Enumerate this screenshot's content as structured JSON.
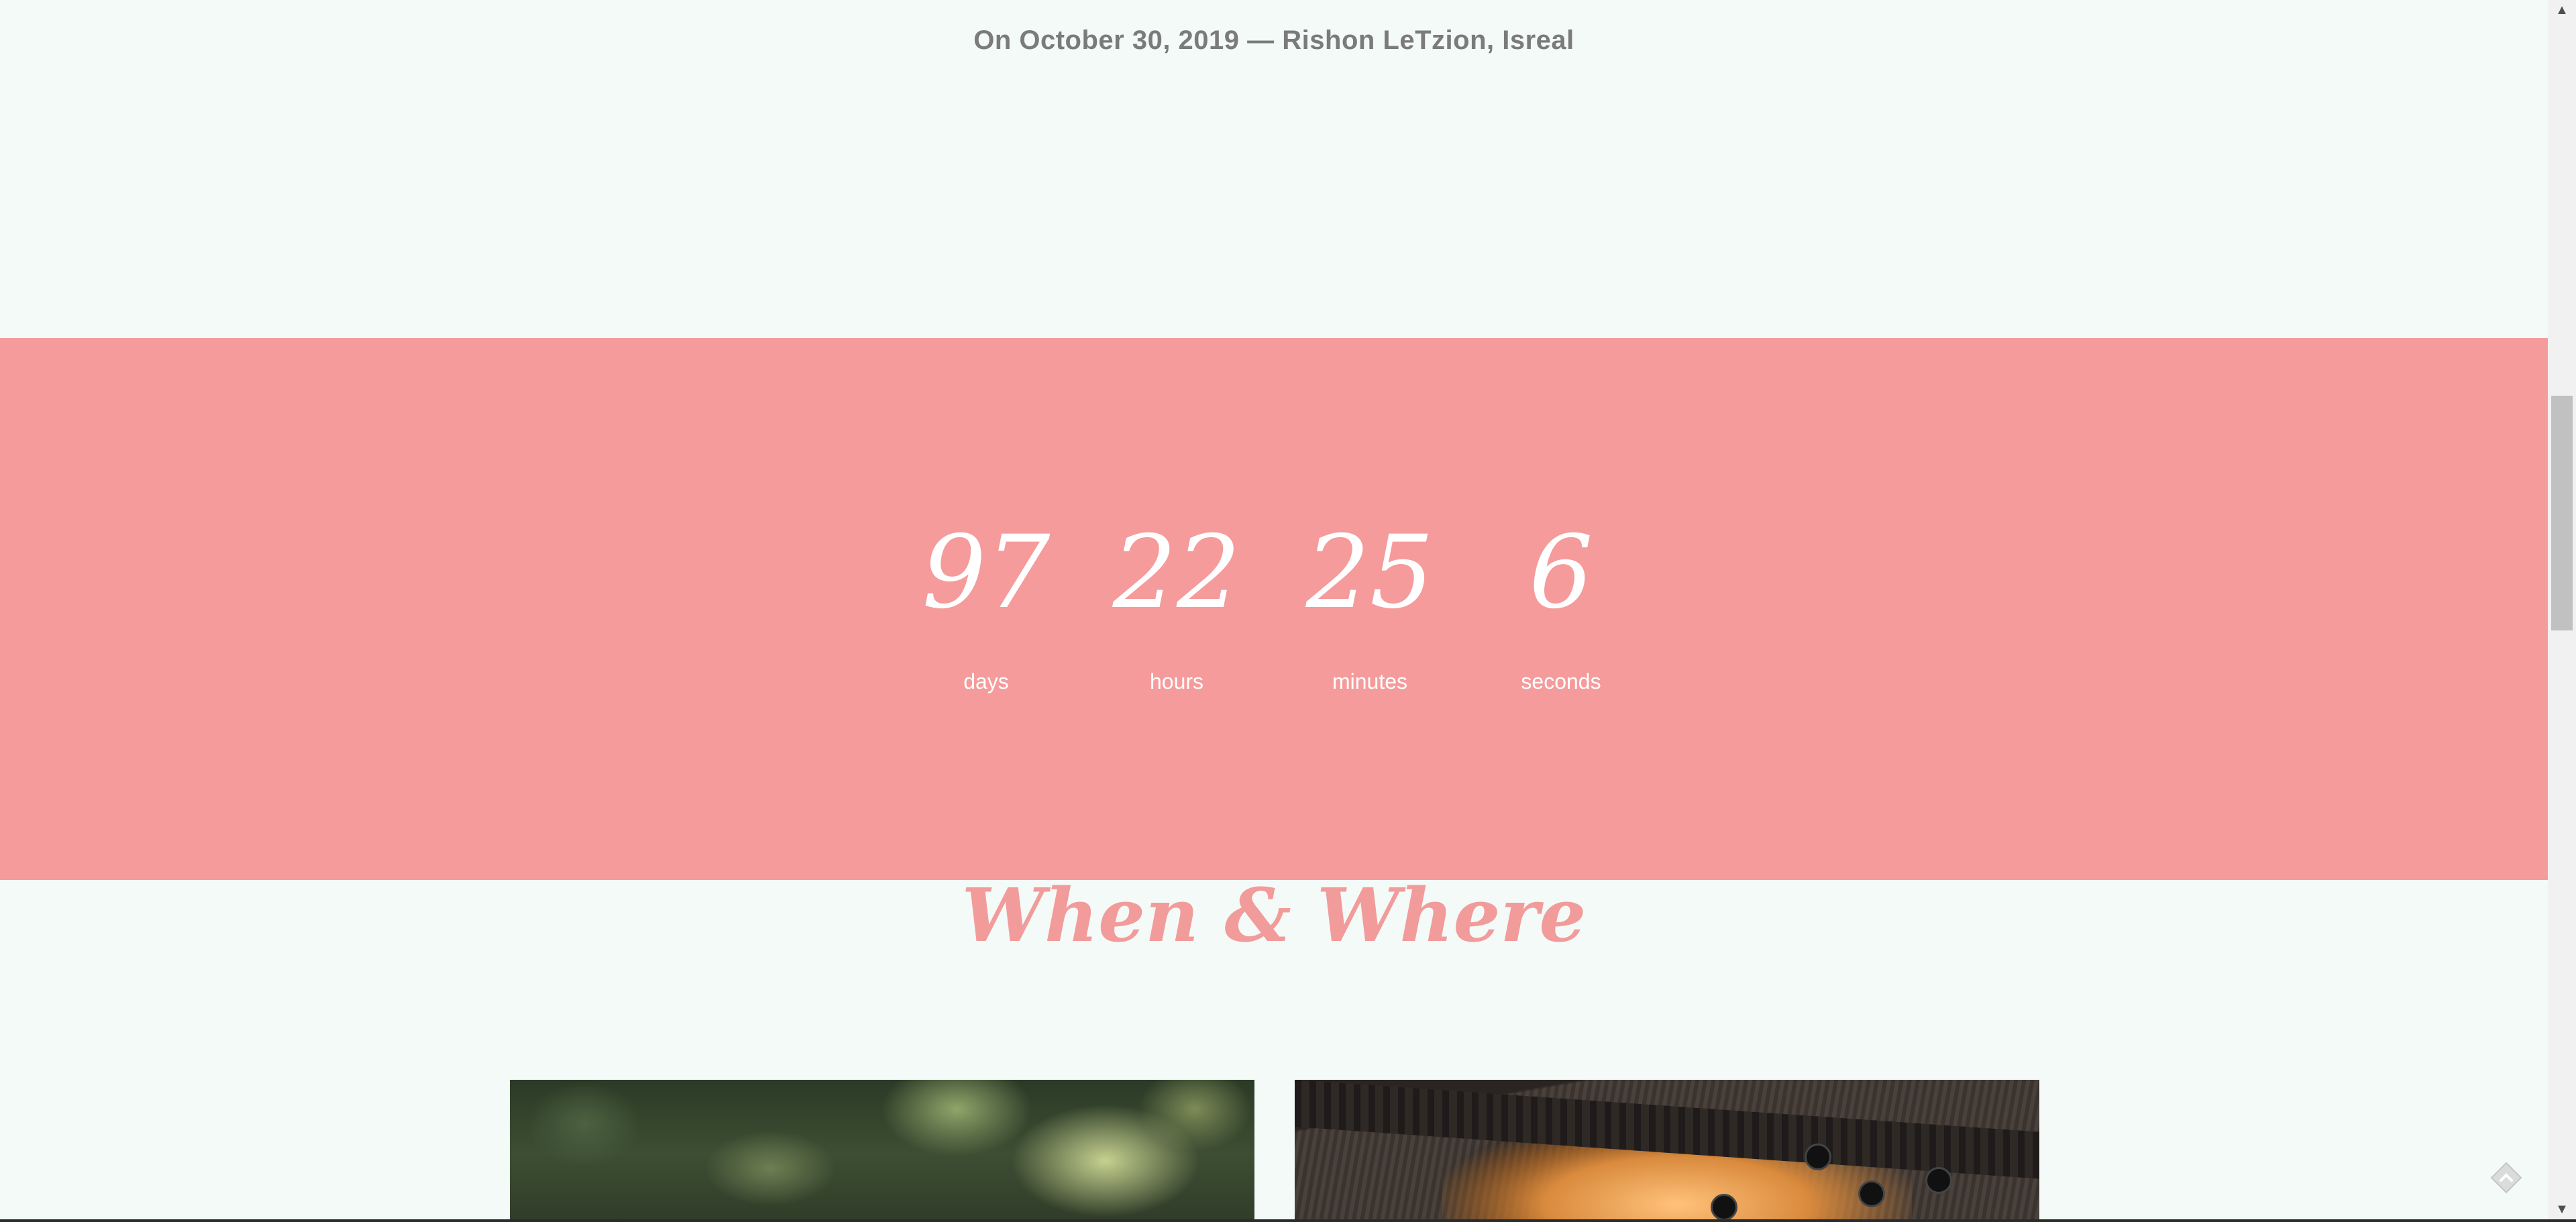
{
  "event": {
    "date_location": "On October 30, 2019 — Rishon LeTzion, Isreal"
  },
  "countdown": {
    "units": [
      {
        "value": "97",
        "label": "days"
      },
      {
        "value": "22",
        "label": "hours"
      },
      {
        "value": "25",
        "label": "minutes"
      },
      {
        "value": "6",
        "label": "seconds"
      }
    ]
  },
  "when_where": {
    "title": "When & Where"
  },
  "colors": {
    "background": "#f4faf7",
    "countdown_bg": "#f59b9b",
    "accent_pink": "#f29b9b",
    "date_text": "#7b7b7b"
  },
  "icons": {
    "scroll_up": "triangle-up",
    "scroll_down": "triangle-down",
    "corner_widget": "feedback-diamond-icon"
  }
}
